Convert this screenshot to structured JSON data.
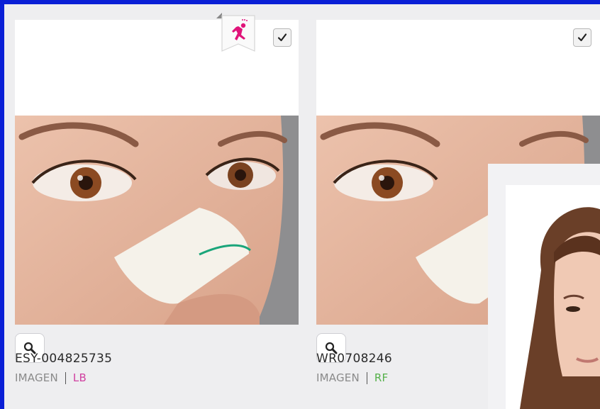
{
  "cards": [
    {
      "id_label": "ESY-004825735",
      "agency": "IMAGEN",
      "license": "LB",
      "license_color": "#d040a0",
      "checked": true,
      "badge_icon": "running-person-icon"
    },
    {
      "id_label": "WR0708246",
      "agency": "IMAGEN",
      "license": "RF",
      "license_color": "#55b04a",
      "checked": true
    }
  ],
  "icons": {
    "zoom": "magnifier-icon",
    "check": "checkmark-icon"
  },
  "colors": {
    "frame": "#0a1fd6",
    "background": "#eeeef0",
    "badge_accent": "#e0147a"
  }
}
